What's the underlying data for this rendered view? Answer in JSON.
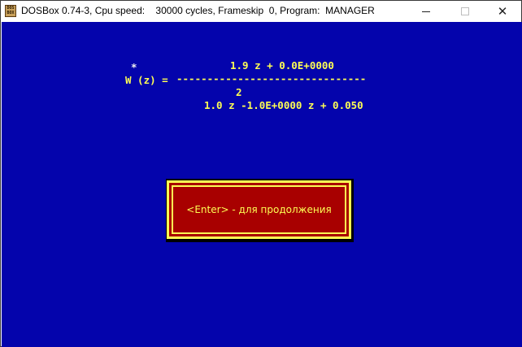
{
  "window": {
    "icon_text_top": "DOS",
    "icon_text_bottom": "BOX",
    "title": "DOSBox 0.74-3, Cpu speed:    30000 cycles, Frameskip  0, Program:  MANAGER",
    "minimize_glyph": "",
    "maximize_glyph": "",
    "close_glyph": "✕"
  },
  "formula": {
    "star": "*",
    "numerator": "1.9 z + 0.0E+0000",
    "lhs": "W (z) =",
    "fraction_bar": "-------------------------------",
    "exponent": "2",
    "denominator": "1.0 z -1.0E+0000 z + 0.050"
  },
  "dialog": {
    "message": "<Enter> - для продолжения"
  },
  "colors": {
    "screen_bg": "#0404ac",
    "text_yellow": "#fdfd54",
    "dialog_bg": "#a80000"
  }
}
